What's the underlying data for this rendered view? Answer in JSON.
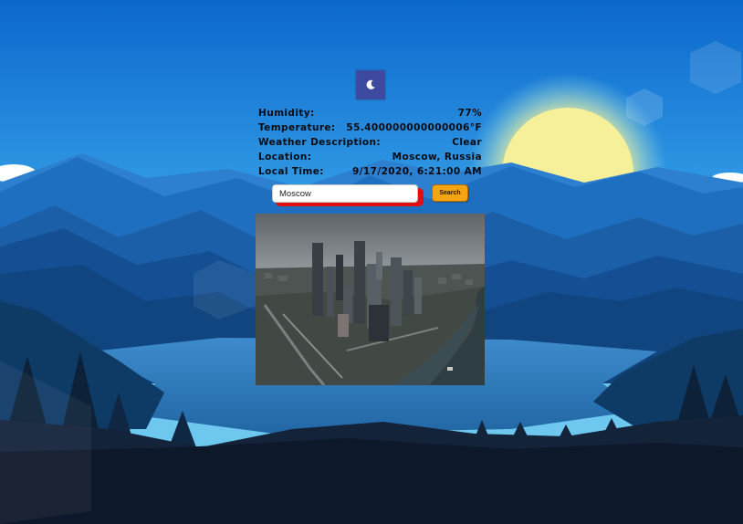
{
  "weather": {
    "icon": "moon-icon",
    "humidity_label": "Humidity:",
    "humidity_value": "77%",
    "temperature_label": "Temperature:",
    "temperature_value": "55.400000000000006°F",
    "description_label": "Weather Description:",
    "description_value": "Clear",
    "location_label": "Location:",
    "location_value": "Moscow, Russia",
    "time_label": "Local Time:",
    "time_value": "9/17/2020, 6:21:00 AM"
  },
  "search": {
    "value": "Moscow",
    "button_label": "Search"
  },
  "colors": {
    "sky_top": "#0f6fcf",
    "sun": "#f3ef9a",
    "icon_bg": "#3d4aa0",
    "button": "#f5a511",
    "input_shadow": "#e01010"
  }
}
